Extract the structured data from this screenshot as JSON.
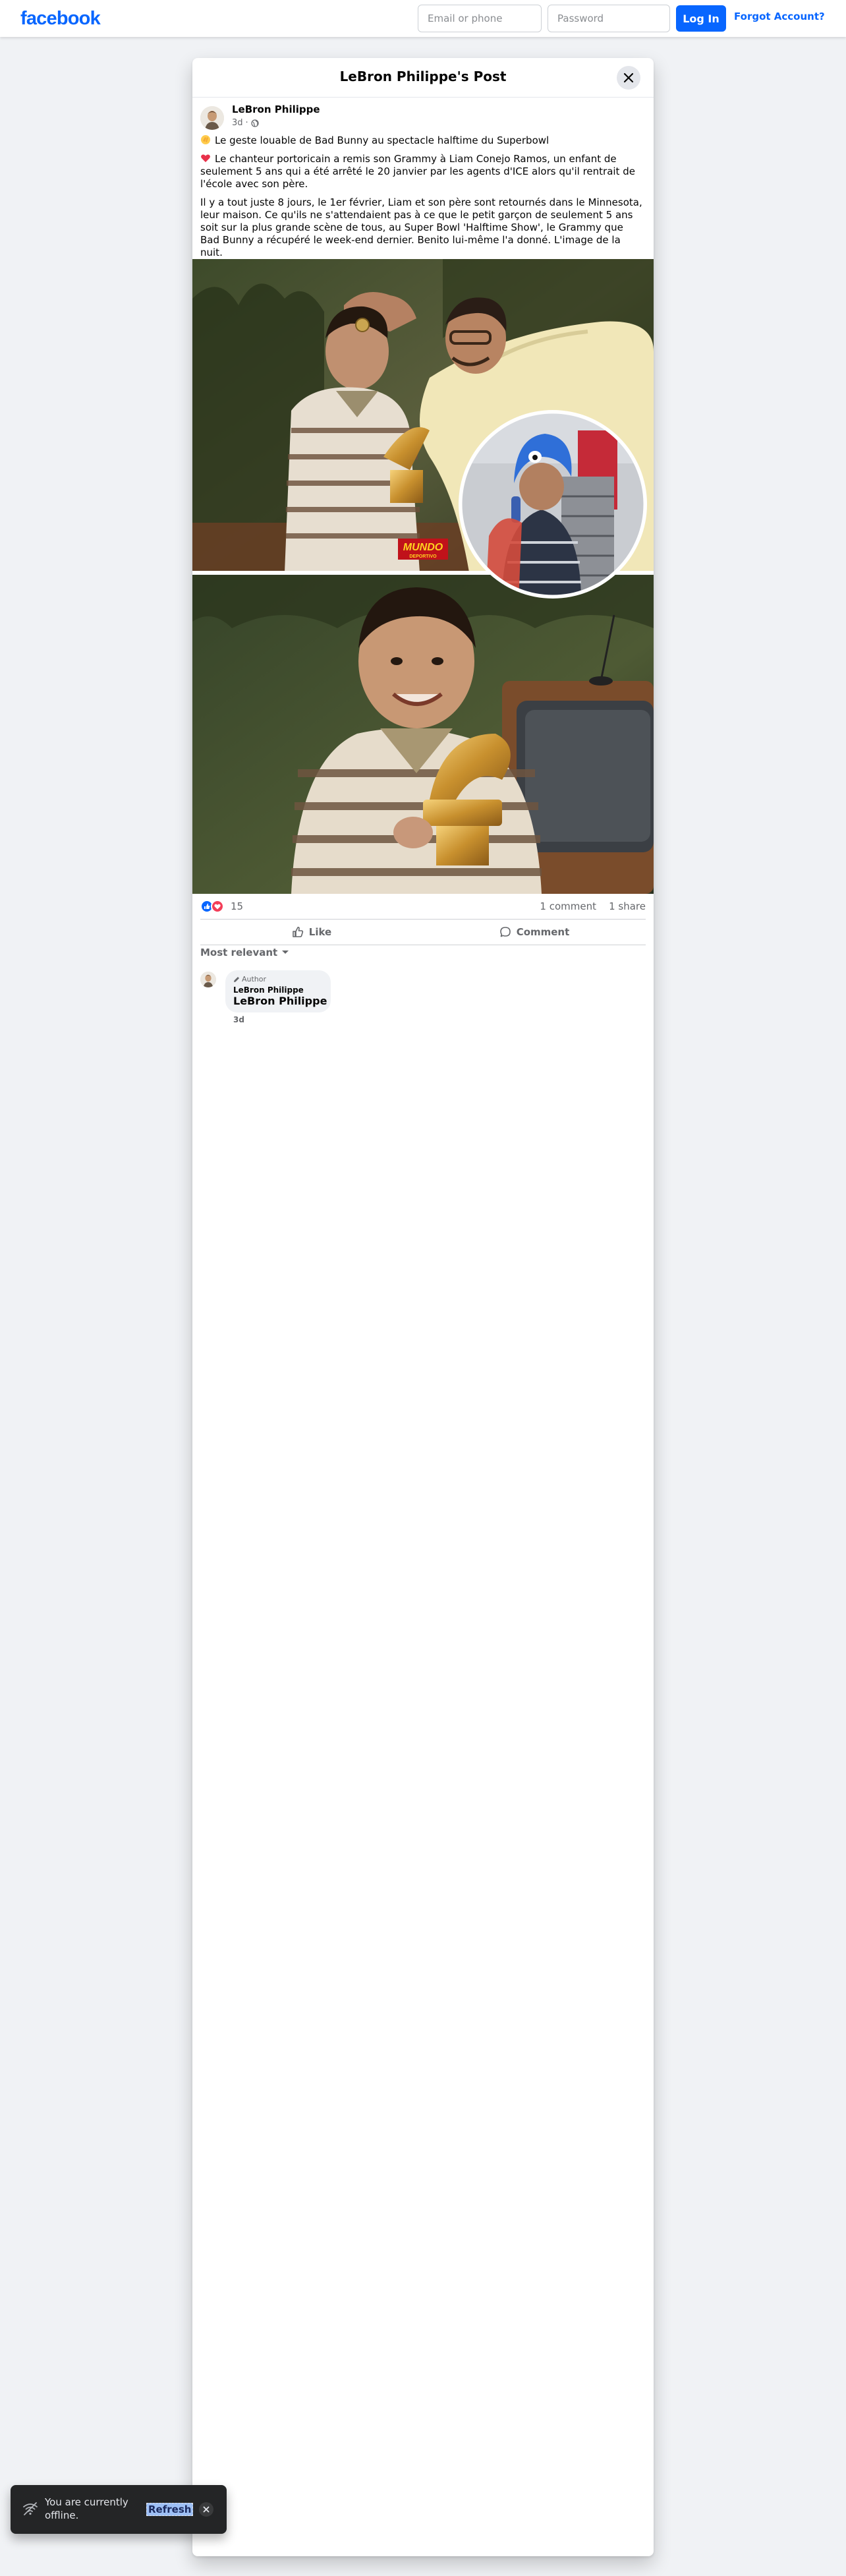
{
  "header": {
    "logo": "facebook",
    "email_placeholder": "Email or phone",
    "password_placeholder": "Password",
    "login_label": "Log In",
    "forgot_label": "Forgot Account?",
    "brand_color": "#0866ff"
  },
  "dialog": {
    "title": "LeBron Philippe's Post"
  },
  "post": {
    "author": "LeBron Philippe",
    "time": "3d",
    "audience_icon": "globe-icon",
    "line1": "Le geste louable de Bad Bunny au spectacle halftime du Superbowl",
    "line2": "Le chanteur portoricain a remis son Grammy à Liam Conejo Ramos, un enfant de seulement 5 ans qui a été arrêté le 20 janvier par les agents d'ICE alors qu'il rentrait de l'école avec son père.",
    "line3": "Il y a tout juste 8 jours, le 1er février, Liam et son père sont retournés dans le Minnesota, leur maison. Ce qu'ils ne s'attendaient pas à ce que le petit garçon de seulement 5 ans soit sur la plus grande scène de tous, au Super Bowl 'Halftime Show', le Grammy que Bad Bunny a récupéré le week-end dernier. Benito lui-même l'a donné. L'image de la nuit.",
    "photo_watermark_line1": "MUNDO",
    "photo_watermark_line2": "DEPORTIVO",
    "reaction_count": "15",
    "comments_count": "1 comment",
    "shares_count": "1 share",
    "like_label": "Like",
    "comment_label": "Comment"
  },
  "comments": {
    "sort_label": "Most relevant",
    "items": [
      {
        "badge": "Author",
        "name_small": "LeBron Philippe",
        "name_big": "LeBron Philippe",
        "time": "3d"
      }
    ]
  },
  "toast": {
    "text": "You are currently offline.",
    "action": "Refresh"
  }
}
